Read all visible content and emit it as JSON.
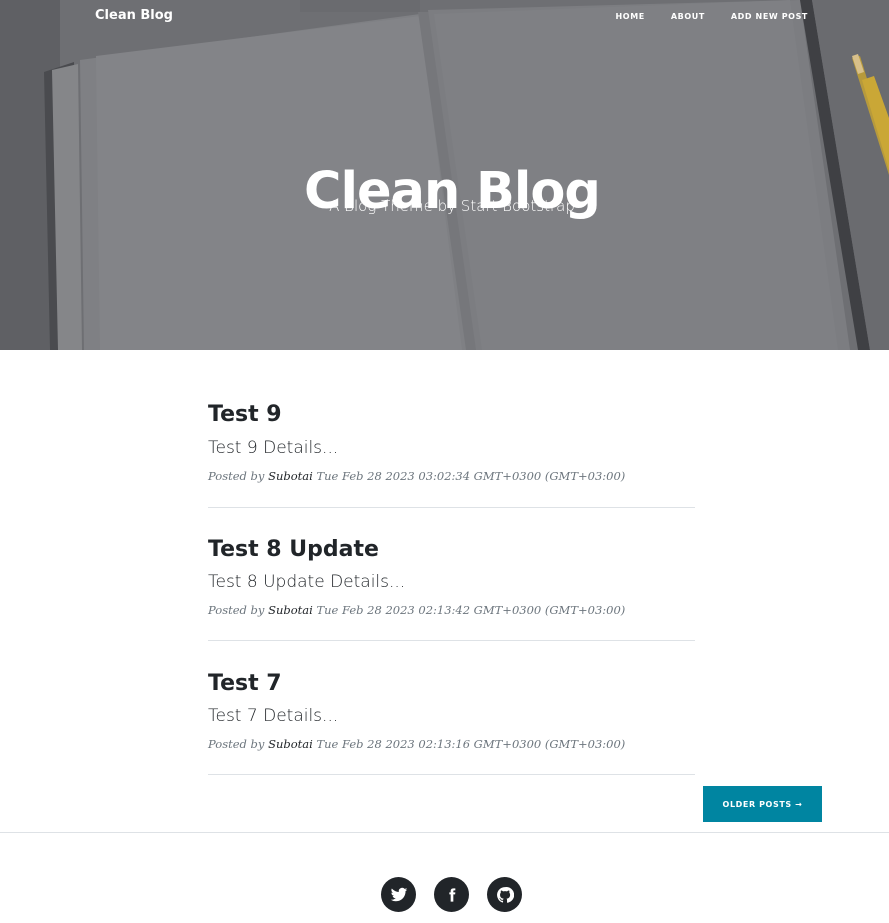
{
  "nav": {
    "brand": "Clean Blog",
    "links": [
      "HOME",
      "ABOUT",
      "ADD NEW POST"
    ]
  },
  "hero": {
    "heading": "Clean Blog",
    "subheading": "A Blog Theme by Start Bootstrap"
  },
  "posts": [
    {
      "title": "Test 9",
      "subtitle": "Test 9 Details...",
      "posted_by": "Posted by",
      "author": "Subotai",
      "date": "Tue Feb 28 2023 03:02:34 GMT+0300 (GMT+03:00)"
    },
    {
      "title": "Test 8 Update",
      "subtitle": "Test 8 Update Details...",
      "posted_by": "Posted by",
      "author": "Subotai",
      "date": "Tue Feb 28 2023 02:13:42 GMT+0300 (GMT+03:00)"
    },
    {
      "title": "Test 7",
      "subtitle": "Test 7 Details...",
      "posted_by": "Posted by",
      "author": "Subotai",
      "date": "Tue Feb 28 2023 02:13:16 GMT+0300 (GMT+03:00)"
    }
  ],
  "pager": {
    "older_label": "OLDER POSTS →"
  },
  "footer": {
    "social": [
      "twitter-icon",
      "facebook-icon",
      "github-icon"
    ]
  },
  "colors": {
    "accent": "#0085a1",
    "text": "#212529",
    "muted": "#6c757d",
    "divider": "#dee2e6",
    "hero_overlay": "#6f7176"
  }
}
